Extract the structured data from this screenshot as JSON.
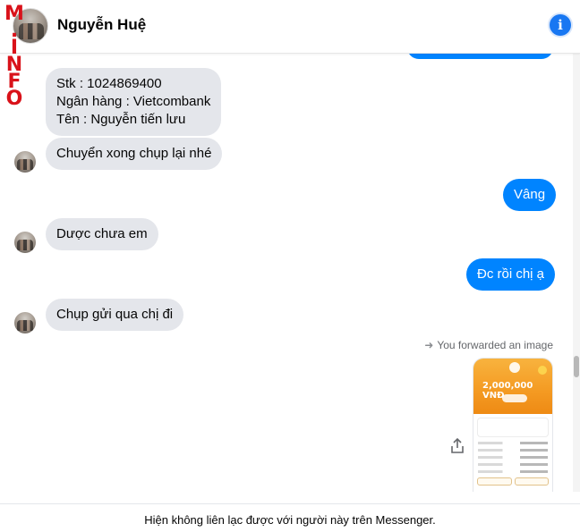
{
  "watermark": {
    "text": "M.INFO"
  },
  "header": {
    "contact_name": "Nguyễn Huệ",
    "info_icon": "info-icon",
    "accent_color": "#1877f2"
  },
  "messages": [
    {
      "direction": "out",
      "partial": true,
      "text": ""
    },
    {
      "direction": "in",
      "lines": [
        "Stk : 1024869400",
        "Ngân hàng : Vietcombank",
        "Tên : Nguyễn tiến lưu"
      ]
    },
    {
      "direction": "in",
      "text": "Chuyển xong chụp lại nhé"
    },
    {
      "direction": "out",
      "text": "Vâng"
    },
    {
      "direction": "in",
      "text": "Dược chưa em"
    },
    {
      "direction": "out",
      "text": "Đc rồi chị ạ"
    },
    {
      "direction": "in",
      "text": "Chụp gửi qua chị đi"
    }
  ],
  "forward_note": {
    "text": "You forwarded an image",
    "icon": "forward-arrow-icon"
  },
  "forwarded_image": {
    "amount": "2,000,000 VNĐ",
    "icon": "share-icon"
  },
  "footer": {
    "text": "Hiện không liên lạc được với người này trên Messenger."
  },
  "colors": {
    "outgoing_bubble": "#0084ff",
    "incoming_bubble": "#e4e6eb",
    "watermark": "#d9121a"
  }
}
